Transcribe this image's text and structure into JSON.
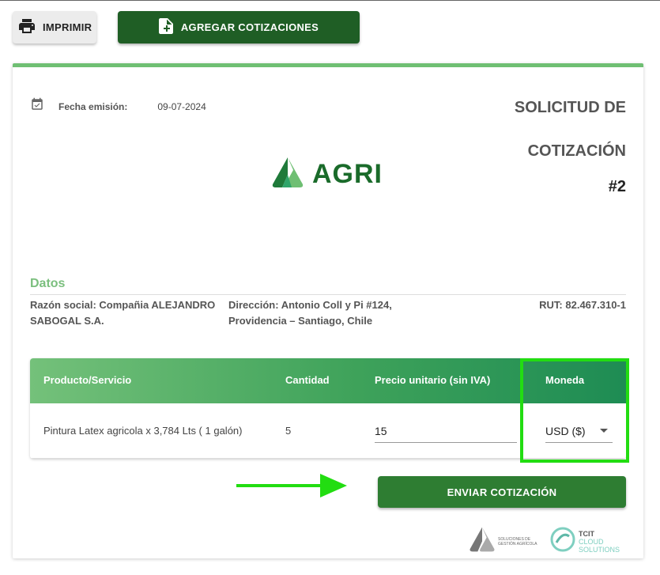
{
  "toolbar": {
    "print_label": "IMPRIMIR",
    "add_label": "AGREGAR COTIZACIONES"
  },
  "header": {
    "date_label": "Fecha emisión:",
    "date_value": "09-07-2024",
    "title_line1": "SOLICITUD DE",
    "title_line2": "COTIZACIÓN",
    "number": "#2",
    "logo_text": "AGRI"
  },
  "datos": {
    "title": "Datos",
    "razon_social": "Razón social: Compañia ALEJANDRO SABOGAL S.A.",
    "direccion": "Dirección: Antonio Coll y Pi #124, Providencia – Santiago, Chile",
    "rut": "RUT: 82.467.310-1"
  },
  "table": {
    "headers": [
      "Producto/Servicio",
      "Cantidad",
      "Precio unitario (sin IVA)",
      "Moneda"
    ],
    "rows": [
      {
        "producto": "Pintura Latex agricola x 3,784 Lts ( 1 galón)",
        "cantidad": "5",
        "precio": "15",
        "moneda": "USD ($)"
      }
    ]
  },
  "actions": {
    "send_label": "ENVIAR COTIZACIÓN"
  },
  "footer": {
    "agri_tagline": "SOLUCIONES DE GESTIÓN AGRÍCOLA",
    "tcit_line1": "TCIT",
    "tcit_line2": "CLOUD",
    "tcit_line3": "SOLUTIONS"
  },
  "colors": {
    "primary_dark": "#1f5e25",
    "primary": "#2e7d32",
    "accent_light": "#6fbf73",
    "highlight": "#22dd11"
  }
}
